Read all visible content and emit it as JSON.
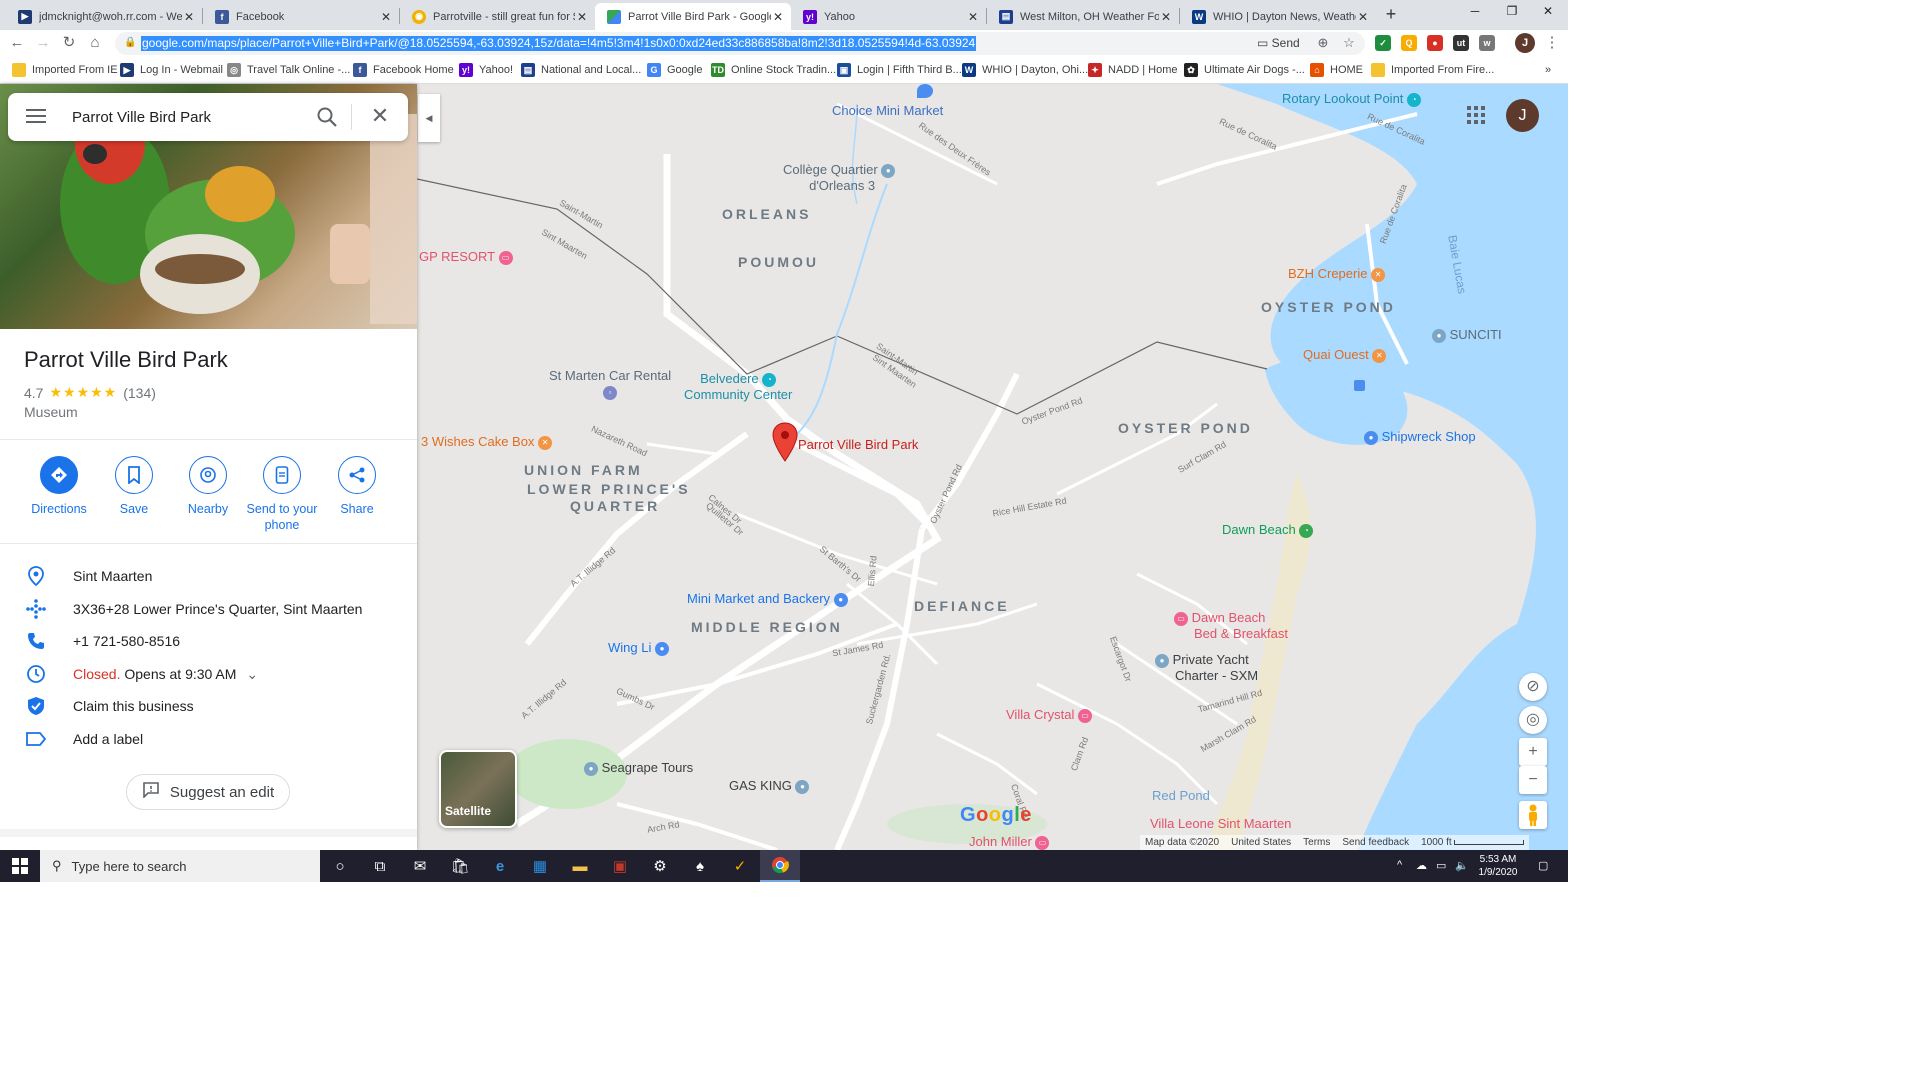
{
  "browser": {
    "tabs": [
      {
        "title": "jdmcknight@woh.rr.com - Webm",
        "favicon": "webmail-icon",
        "color": "#1f3b73",
        "active": false
      },
      {
        "title": "Facebook",
        "favicon": "facebook-icon",
        "color": "#3b5998",
        "active": false
      },
      {
        "title": "Parrotville - still great fun for $10",
        "favicon": "tripadvisor-icon",
        "color": "#f2b203",
        "active": false
      },
      {
        "title": "Parrot Ville Bird Park - Google M",
        "favicon": "google-maps-icon",
        "color": "#34a853",
        "active": true
      },
      {
        "title": "Yahoo",
        "favicon": "yahoo-icon",
        "color": "#6001d2",
        "active": false
      },
      {
        "title": "West Milton, OH Weather Foreca",
        "favicon": "weather-icon",
        "color": "#1d3f8f",
        "active": false
      },
      {
        "title": "WHIO | Dayton News, Weather &",
        "favicon": "whio-icon",
        "color": "#0a3a82",
        "active": false
      }
    ],
    "new_tab": "+",
    "window": {
      "minimize": "─",
      "maximize": "❐",
      "close": "✕"
    },
    "url": "google.com/maps/place/Parrot+Ville+Bird+Park/@18.0525594,-63.03924,15z/data=!4m5!3m4!1s0x0:0xd24ed33c886858ba!8m2!3d18.0525594!4d-63.03924",
    "send_label": "Send",
    "bookmarks": [
      {
        "label": "Imported From IE",
        "color": "#f4c430"
      },
      {
        "label": "Log In - Webmail",
        "color": "#1f3b73"
      },
      {
        "label": "Travel Talk Online -...",
        "color": "#888888"
      },
      {
        "label": "Facebook  Home",
        "color": "#3b5998"
      },
      {
        "label": "Yahoo!",
        "color": "#6001d2"
      },
      {
        "label": "National and Local...",
        "color": "#1d3f8f"
      },
      {
        "label": "Google",
        "color": "#4285f4"
      },
      {
        "label": "Online Stock Tradin...",
        "color": "#2e8b2e"
      },
      {
        "label": "Login | Fifth Third B...",
        "color": "#1b4f9c"
      },
      {
        "label": "WHIO | Dayton, Ohi...",
        "color": "#0a3a82"
      },
      {
        "label": "NADD | Home",
        "color": "#c62828"
      },
      {
        "label": "Ultimate Air Dogs -...",
        "color": "#222222"
      },
      {
        "label": "HOME",
        "color": "#e65100"
      },
      {
        "label": "Imported From Fire...",
        "color": "#f4c430"
      }
    ],
    "bookmarks_more": "»"
  },
  "maps": {
    "search_value": "Parrot Ville Bird Park",
    "place": {
      "name": "Parrot Ville Bird Park",
      "rating": "4.7",
      "stars": "★★★★★",
      "reviews": "(134)",
      "category": "Museum"
    },
    "actions": [
      {
        "label": "Directions",
        "icon": "directions-icon"
      },
      {
        "label": "Save",
        "icon": "bookmark-icon"
      },
      {
        "label": "Nearby",
        "icon": "nearby-icon"
      },
      {
        "label": "Send to your phone",
        "icon": "phone-send-icon"
      },
      {
        "label": "Share",
        "icon": "share-icon"
      }
    ],
    "info": {
      "location": "Sint Maarten",
      "plus_code": "3X36+28 Lower Prince's Quarter, Sint Maarten",
      "phone": "+1 721-580-8516",
      "status_closed": "Closed.",
      "status_opens": "Opens at 9:30 AM",
      "claim": "Claim this business",
      "label": "Add a label"
    },
    "suggest_edit": "Suggest an edit",
    "satellite_label": "Satellite",
    "avatar_initial": "J",
    "attribution": {
      "map_data": "Map data ©2020",
      "country": "United States",
      "terms": "Terms",
      "feedback": "Send feedback",
      "scale": "1000 ft"
    },
    "google_logo": "Google",
    "map_labels": {
      "choice": "Choice Mini Market",
      "rotary": "Rotary Lookout Point",
      "college": "Collège Quartier",
      "college2": "d'Orleans 3",
      "orleans": "ORLEANS",
      "poumou": "POUMOU",
      "gpresort": "GP RESORT",
      "bzh": "BZH Creperie",
      "oyster1": "OYSTER POND",
      "suncity": "SUNCITI",
      "quai": "Quai Ouest",
      "carrental": "St Marten Car Rental",
      "belvedere": "Belvedere",
      "belvedere2": "Community Center",
      "parrot": "Parrot Ville Bird Park",
      "wishes": "3 Wishes Cake Box",
      "oyster2": "OYSTER POND",
      "shipwreck": "Shipwreck Shop",
      "union": "UNION FARM",
      "lpq1": "LOWER PRINCE'S",
      "lpq2": "QUARTER",
      "dawnbeach": "Dawn Beach",
      "minimarket": "Mini Market and Backery",
      "defiance": "DEFIANCE",
      "middle": "MIDDLE REGION",
      "dawnbb1": "Dawn Beach",
      "dawnbb2": "Bed & Breakfast",
      "wingli": "Wing Li",
      "privateyacht1": "Private Yacht",
      "privateyacht2": "Charter - SXM",
      "villacrystal": "Villa Crystal",
      "seagrape": "Seagrape Tours",
      "gasking": "GAS KING",
      "redpond": "Red Pond",
      "villaleone": "Villa Leone Sint Maarten",
      "johnmiller": "John Miller",
      "baielucas": "Baie Lucas"
    },
    "street_labels": {
      "s1": "Saint-Martin",
      "s2": "Sint Maarten",
      "s3": "Rue des Deux Frères",
      "s4": "Rue de Coralita",
      "s5": "Rue de Coralita",
      "s6": "Saint-Martin",
      "s7": "Sint Maarten",
      "s8": "Oyster Pond Rd",
      "s9": "Nazareth Road",
      "s10": "Oyster Pond Rd",
      "s11": "A.T. Illidge Rd",
      "s12": "Suckergarden Rd.",
      "s13": "A.T. Illidge Rd",
      "s14": "Arch Rd",
      "s15": "Rice Hill Estate Rd",
      "s16": "Surf Clam Rd",
      "s17": "Tamarind Hill Rd",
      "s18": "Rue de Coralita",
      "s19": "Calnes Dr",
      "s20": "Quilletor Dr",
      "s21": "St Barth's Dr",
      "s22": "Ellis Rd",
      "s23": "St James Rd",
      "s24": "Gumbs Dr",
      "s25": "Clam Rd",
      "s26": "Marsh Clam Rd",
      "s27": "Escargot Dr",
      "s28": "Coral Rd"
    }
  },
  "taskbar": {
    "search_placeholder": "Type here to search",
    "time": "5:53 AM",
    "date": "1/9/2020"
  }
}
